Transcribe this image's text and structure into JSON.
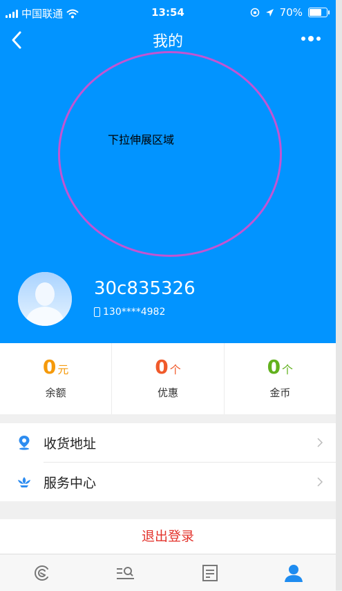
{
  "status_bar": {
    "carrier": "中国联通",
    "time": "13:54",
    "battery": "70%",
    "battery_level": 0.7
  },
  "header": {
    "title": "我的",
    "back_icon": "chevron-left-icon",
    "more_icon": "more-dots-icon"
  },
  "annotation": {
    "text": "下拉伸展区域"
  },
  "profile": {
    "username": "30c835326",
    "phone": "130****4982"
  },
  "stats": [
    {
      "value": "0",
      "unit": "元",
      "label": "余额",
      "color": "#f59a0b"
    },
    {
      "value": "0",
      "unit": "个",
      "label": "优惠",
      "color": "#f05a2b"
    },
    {
      "value": "0",
      "unit": "个",
      "label": "金币",
      "color": "#62b11e"
    }
  ],
  "menu": [
    {
      "label": "收货地址",
      "icon": "location-pin-icon"
    },
    {
      "label": "服务中心",
      "icon": "service-lotus-icon"
    }
  ],
  "logout": {
    "label": "退出登录"
  },
  "tabbar": {
    "tabs": [
      {
        "icon": "home-logo-icon"
      },
      {
        "icon": "search-list-icon"
      },
      {
        "icon": "orders-icon"
      },
      {
        "icon": "profile-icon",
        "active": true
      }
    ]
  },
  "colors": {
    "header_bg": "#0294ff",
    "annotation_outline": "#c255d2",
    "logout_text": "#e3322b",
    "tab_active": "#1e8cf0",
    "tab_inactive": "#777777"
  }
}
